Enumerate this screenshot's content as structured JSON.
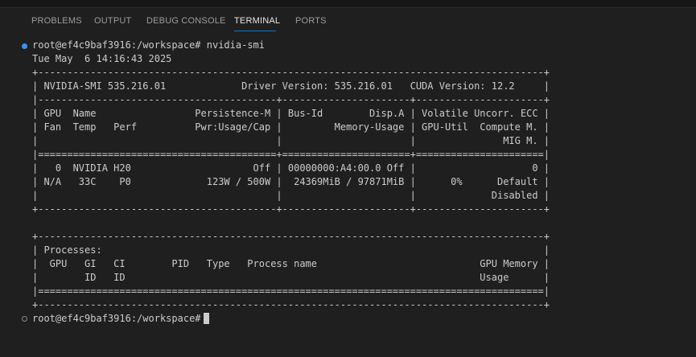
{
  "panel": {
    "tabs": [
      {
        "label": "PROBLEMS"
      },
      {
        "label": "OUTPUT"
      },
      {
        "label": "DEBUG CONSOLE"
      },
      {
        "label": "TERMINAL"
      },
      {
        "label": "PORTS"
      }
    ],
    "active_tab": "TERMINAL"
  },
  "terminal": {
    "prompt": "root@ef4c9baf3916:/workspace#",
    "command": "nvidia-smi",
    "output": [
      "Tue May  6 14:16:43 2025",
      "+---------------------------------------------------------------------------------------+",
      "| NVIDIA-SMI 535.216.01             Driver Version: 535.216.01   CUDA Version: 12.2     |",
      "|-----------------------------------------+----------------------+----------------------+",
      "| GPU  Name                 Persistence-M | Bus-Id        Disp.A | Volatile Uncorr. ECC |",
      "| Fan  Temp   Perf          Pwr:Usage/Cap |         Memory-Usage | GPU-Util  Compute M. |",
      "|                                         |                      |               MIG M. |",
      "|=========================================+======================+======================|",
      "|   0  NVIDIA H20                     Off | 00000000:A4:00.0 Off |                    0 |",
      "| N/A   33C    P0             123W / 500W |  24369MiB / 97871MiB |      0%      Default |",
      "|                                         |                      |             Disabled |",
      "+-----------------------------------------+----------------------+----------------------+",
      "",
      "+---------------------------------------------------------------------------------------+",
      "| Processes:                                                                            |",
      "|  GPU   GI   CI        PID   Type   Process name                            GPU Memory |",
      "|        ID   ID                                                             Usage      |",
      "|=======================================================================================|",
      "+---------------------------------------------------------------------------------------+"
    ]
  },
  "colors": {
    "background": "#1f1f1f",
    "terminal_text": "#cccccc",
    "active_tab_underline": "#0078d4",
    "command_decoration": "#3794ff"
  },
  "icons": {
    "command_success": "circle-filled-icon",
    "command_pending": "circle-outline-icon"
  }
}
